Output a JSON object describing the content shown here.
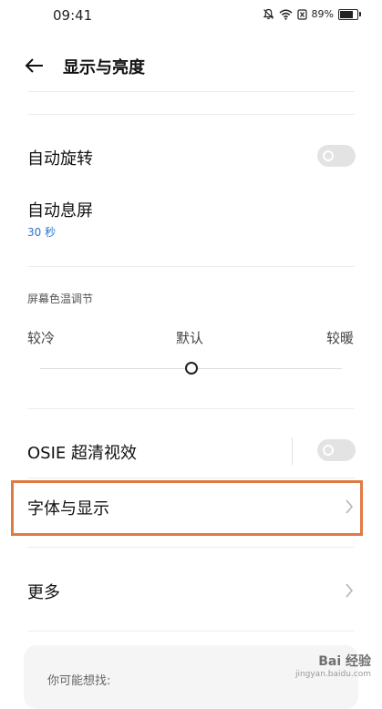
{
  "status_bar": {
    "time": "09:41",
    "battery_text": "89%",
    "battery_level": 0.89
  },
  "header": {
    "title": "显示与亮度"
  },
  "auto_rotate": {
    "label": "自动旋转",
    "enabled": false
  },
  "auto_sleep": {
    "label": "自动息屏",
    "value": "30 秒"
  },
  "color_temp": {
    "section_label": "屏幕色温调节",
    "cold_label": "较冷",
    "default_label": "默认",
    "warm_label": "较暖",
    "level": 0.5
  },
  "osie": {
    "label": "OSIE 超清视效",
    "enabled": false
  },
  "font_display": {
    "label": "字体与显示"
  },
  "more": {
    "label": "更多"
  },
  "suggestions": {
    "title": "你可能想找:"
  },
  "watermark": {
    "text": "Bai 经验",
    "sub": "jingyan.baidu.com"
  },
  "colors": {
    "accent": "#2b76c8",
    "highlight": "#e07a45",
    "toggle_off": "#e3e3e3"
  }
}
